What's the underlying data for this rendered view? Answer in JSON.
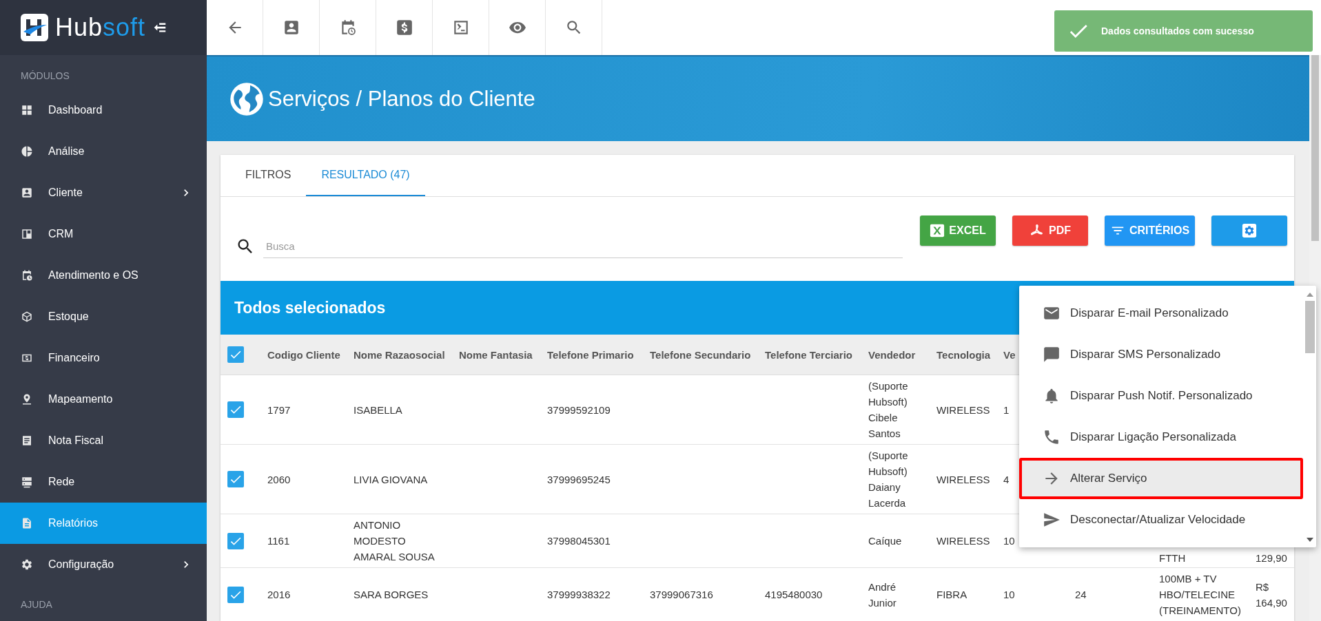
{
  "logo": {
    "primary": "Hub",
    "accent": "soft"
  },
  "sidebar": {
    "section": "MÓDULOS",
    "footer_section": "AJUDA",
    "items": [
      {
        "label": "Dashboard",
        "selected": false,
        "expandable": false
      },
      {
        "label": "Análise",
        "selected": false,
        "expandable": false
      },
      {
        "label": "Cliente",
        "selected": false,
        "expandable": true
      },
      {
        "label": "CRM",
        "selected": false,
        "expandable": false
      },
      {
        "label": "Atendimento e OS",
        "selected": false,
        "expandable": false
      },
      {
        "label": "Estoque",
        "selected": false,
        "expandable": false
      },
      {
        "label": "Financeiro",
        "selected": false,
        "expandable": false
      },
      {
        "label": "Mapeamento",
        "selected": false,
        "expandable": false
      },
      {
        "label": "Nota Fiscal",
        "selected": false,
        "expandable": false
      },
      {
        "label": "Rede",
        "selected": false,
        "expandable": false
      },
      {
        "label": "Relatórios",
        "selected": true,
        "expandable": false
      },
      {
        "label": "Configuração",
        "selected": false,
        "expandable": true
      }
    ]
  },
  "toast": {
    "message": "Dados consultados com sucesso"
  },
  "page_title": "Serviços / Planos do Cliente",
  "tabs": [
    {
      "label": "FILTROS",
      "selected": false
    },
    {
      "label": "RESULTADO (47)",
      "selected": true
    }
  ],
  "search": {
    "placeholder": "Busca"
  },
  "actions": [
    {
      "kind": "excel",
      "label": "EXCEL"
    },
    {
      "kind": "pdf",
      "label": "PDF"
    },
    {
      "kind": "criteria",
      "label": "CRITÉRIOS"
    },
    {
      "kind": "settings"
    }
  ],
  "selection_bar": "Todos selecionados",
  "table": {
    "all_checked": true,
    "columns": [
      "Codigo Cliente",
      "Nome Razaosocial",
      "Nome Fantasia",
      "Telefone Primario",
      "Telefone Secundario",
      "Telefone Terciario",
      "Vendedor",
      "Tecnologia",
      "Ve"
    ],
    "rows": [
      {
        "selected": true,
        "code": "1797",
        "name": "ISABELLA",
        "phone1": "37999592109",
        "seller": "(Suporte Hubsoft) Cibele Santos",
        "tech": "WIRELESS",
        "col_10": "1"
      },
      {
        "selected": true,
        "code": "2060",
        "name": "LIVIA GIOVANA",
        "phone1": "37999695245",
        "seller": "(Suporte Hubsoft) Daiany Lacerda",
        "tech": "WIRELESS",
        "col_10": "4"
      },
      {
        "selected": true,
        "code": "1161",
        "name": "ANTONIO MODESTO AMARAL SOUSA",
        "phone1": "37998045301",
        "seller": "Caíque",
        "tech": "WIRELESS",
        "col_10": "10",
        "col_12": "FTTH",
        "col_13": "129,90"
      },
      {
        "selected": true,
        "code": "2016",
        "name": "SARA BORGES",
        "phone1": "37999938322",
        "phone2": "37999067316",
        "phone3": "4195480030",
        "seller": "André Junior",
        "tech": "FIBRA",
        "col_10": "10",
        "col_11": "24",
        "col_12": "100MB + TV HBO/TELECINE (TREINAMENTO)",
        "col_13": "R$ 164,90"
      }
    ]
  },
  "context_menu": {
    "items": [
      {
        "label": "Disparar E-mail Personalizado",
        "selected": false
      },
      {
        "label": "Disparar SMS Personalizado",
        "selected": false
      },
      {
        "label": "Disparar Push Notif. Personalizado",
        "selected": false
      },
      {
        "label": "Disparar Ligação Personalizada",
        "selected": false
      },
      {
        "label": "Alterar Serviço",
        "selected": true
      },
      {
        "label": "Desconectar/Atualizar Velocidade",
        "selected": false
      }
    ]
  }
}
